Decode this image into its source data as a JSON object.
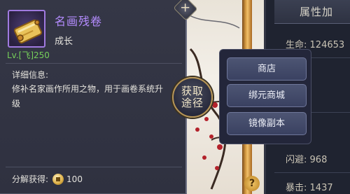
{
  "item": {
    "name": "名画残卷",
    "type": "成长",
    "level": "Lv.[飞]250",
    "detail_title": "详细信息:",
    "description": "修补名家画作所用之物，用于画卷系统升级",
    "decompose_label": "分解获得:",
    "decompose_value": "100",
    "icon": "scroll-icon",
    "name_color": "#b48cff"
  },
  "obtain": {
    "line1": "获取",
    "line2": "途径"
  },
  "sources": [
    {
      "label": "商店"
    },
    {
      "label": "绑元商城"
    },
    {
      "label": "镜像副本"
    }
  ],
  "attributes": {
    "header": "属性加",
    "stats": [
      {
        "label": "生命:",
        "value": "124653"
      },
      {
        "label": "闪避:",
        "value": "968"
      },
      {
        "label": "暴击:",
        "value": "1437"
      }
    ]
  },
  "help_icon": "?",
  "close_icon": "+"
}
